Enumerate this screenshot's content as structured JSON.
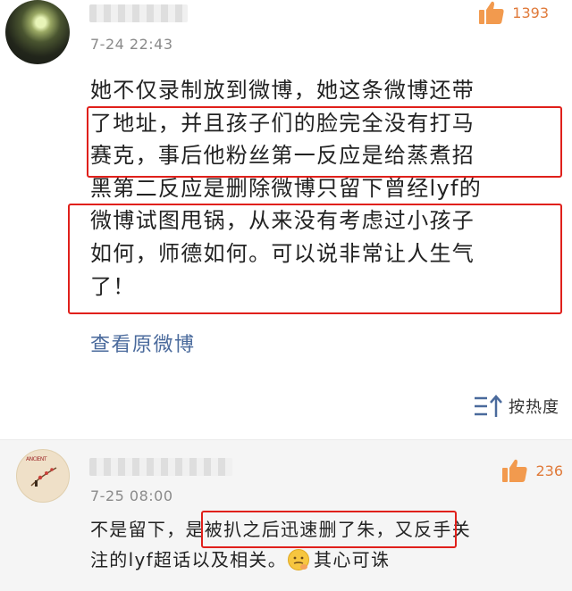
{
  "comments": [
    {
      "time": "7-24 22:43",
      "likes": "1393",
      "body_lines": [
        "她不仅录制放到微博，她这条微博还带",
        "了地址，并且孩子们的脸完全没有打马",
        "赛克，事后他粉丝第一反应是给蒸煮招",
        "黑第二反应是删除微博只留下曾经lyf的",
        "微博试图甩锅，从来没有考虑过小孩子",
        "如何，师德如何。可以说非常让人生气",
        "了！"
      ],
      "view_original": "查看原微博"
    },
    {
      "time": "7-25 08:00",
      "likes": "236",
      "line1_a": "不是留下，",
      "line1_b": "是被扒之后迅速删了朱",
      "line1_c": "，又反手关",
      "line2_a": "注的lyf超话以及相关。",
      "line2_b": "其心可诛",
      "avatar_text": "ANCIENT"
    }
  ],
  "sort_label": "按热度",
  "icons": {
    "like": "thumbs-up-icon",
    "sort": "sort-icon",
    "emoji": "thinking-emoji-icon"
  },
  "colors": {
    "like": "#e07a3a",
    "link": "#4a6a9c",
    "highlight_box": "#e0201b",
    "time": "#8a8a8a"
  }
}
